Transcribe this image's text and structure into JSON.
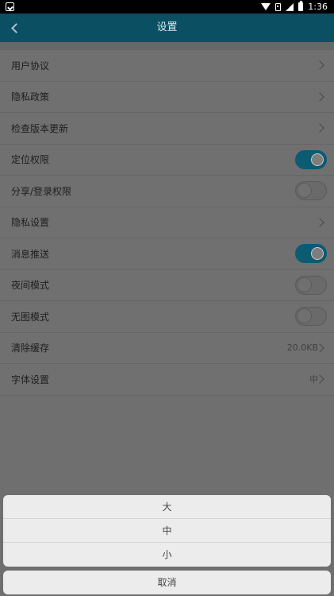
{
  "status_bar": {
    "time": "1:36"
  },
  "header": {
    "title": "设置"
  },
  "settings": [
    {
      "label": "用户协议",
      "kind": "link"
    },
    {
      "label": "隐私政策",
      "kind": "link"
    },
    {
      "label": "检查版本更新",
      "kind": "link"
    },
    {
      "label": "定位权限",
      "kind": "toggle",
      "on": true
    },
    {
      "label": "分享/登录权限",
      "kind": "toggle",
      "on": false
    },
    {
      "label": "隐私设置",
      "kind": "link"
    },
    {
      "label": "消息推送",
      "kind": "toggle",
      "on": true
    },
    {
      "label": "夜间模式",
      "kind": "toggle",
      "on": false
    },
    {
      "label": "无图模式",
      "kind": "toggle",
      "on": false
    },
    {
      "label": "清除缓存",
      "kind": "link",
      "value": "20.0KB"
    },
    {
      "label": "字体设置",
      "kind": "link",
      "value": "中"
    }
  ],
  "font_sheet": {
    "options": [
      "大",
      "中",
      "小"
    ],
    "cancel_label": "取消"
  },
  "colors": {
    "app_bar": "#0b4f63",
    "toggle_on": "#0b5b73",
    "sheet": "#ececec"
  }
}
